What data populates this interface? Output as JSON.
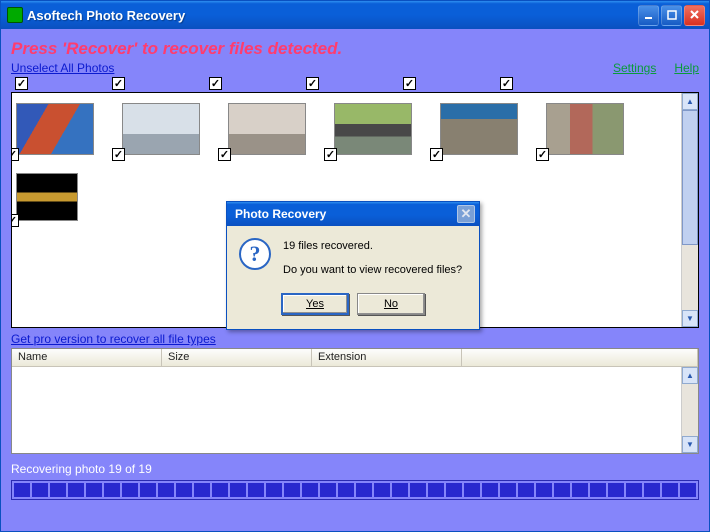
{
  "window": {
    "title": "Asoftech Photo Recovery"
  },
  "instruction": "Press 'Recover' to recover files detected.",
  "links": {
    "unselect": "Unselect All Photos",
    "settings": "Settings",
    "help": "Help",
    "pro": "Get pro version to recover all file types"
  },
  "table": {
    "cols": {
      "name": "Name",
      "size": "Size",
      "ext": "Extension"
    }
  },
  "status": "Recovering photo 19 of 19",
  "dialog": {
    "title": "Photo Recovery",
    "line1": "19 files recovered.",
    "line2": "Do you want to view recovered files?",
    "yes": "Yes",
    "no": "No"
  }
}
